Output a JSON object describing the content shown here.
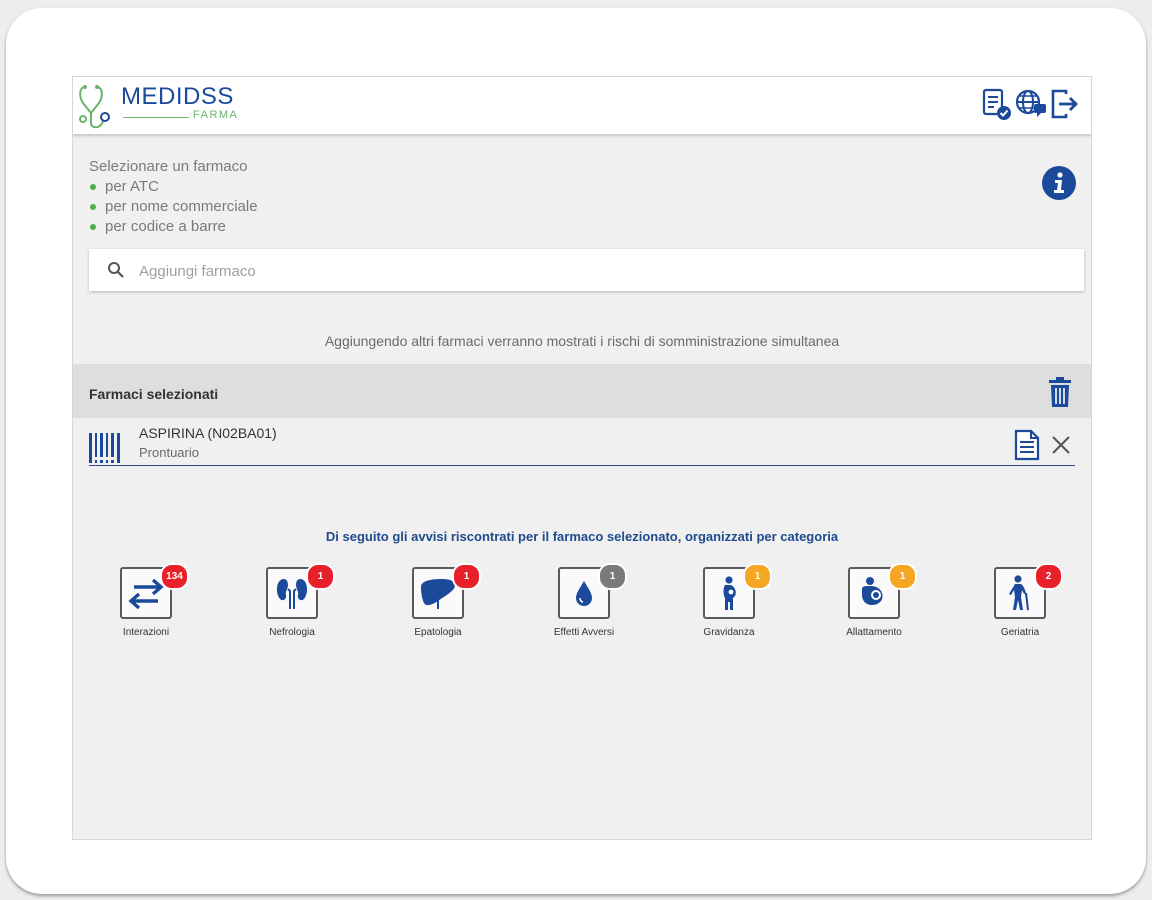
{
  "app": {
    "brand_name": "MEDIDSS",
    "brand_sub": "FARMA",
    "accent_color": "#1b4a9a",
    "green_color": "#6bb36b"
  },
  "toolbar": {
    "icons": [
      "report-icon",
      "globe-chat-icon",
      "logout-icon"
    ]
  },
  "intro": {
    "title": "Selezionare un farmaco",
    "options": [
      "per ATC",
      "per nome commerciale",
      "per codice a barre"
    ]
  },
  "search": {
    "placeholder": "Aggiungi farmaco",
    "value": ""
  },
  "hint": "Aggiungendo altri farmaci verranno mostrati i rischi di somministrazione simultanea",
  "selected": {
    "title": "Farmaci selezionati",
    "items": [
      {
        "name": "ASPIRINA (N02BA01)",
        "source": "Prontuario"
      }
    ]
  },
  "alerts": {
    "title": "Di seguito gli avvisi riscontrati per il farmaco selezionato, organizzati per categoria",
    "categories": [
      {
        "label": "Interazioni",
        "count": "134",
        "badge_color": "#e8202a",
        "icon": "arrows-swap-icon"
      },
      {
        "label": "Nefrologia",
        "count": "1",
        "badge_color": "#e8202a",
        "icon": "kidneys-icon"
      },
      {
        "label": "Epatologia",
        "count": "1",
        "badge_color": "#e8202a",
        "icon": "liver-icon"
      },
      {
        "label": "Effetti Avversi",
        "count": "1",
        "badge_color": "#7a7a7a",
        "icon": "drop-icon"
      },
      {
        "label": "Gravidanza",
        "count": "1",
        "badge_color": "#f5a623",
        "icon": "pregnant-icon"
      },
      {
        "label": "Allattamento",
        "count": "1",
        "badge_color": "#f5a623",
        "icon": "breastfeeding-icon"
      },
      {
        "label": "Geriatria",
        "count": "2",
        "badge_color": "#e8202a",
        "icon": "elderly-icon"
      }
    ]
  }
}
